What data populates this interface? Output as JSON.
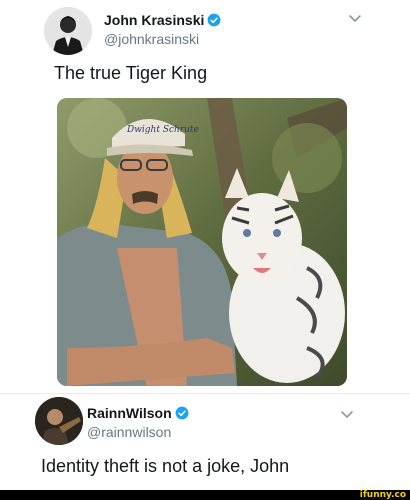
{
  "tweet1": {
    "name": "John Krasinski",
    "handle": "@johnkrasinski",
    "text": "The true Tiger King",
    "avatar_icon": "person-suit-avatar",
    "verified_icon": "verified-badge-icon",
    "menu_icon": "chevron-down-icon"
  },
  "tweet2": {
    "name": "RainnWilson",
    "handle": "@rainnwilson",
    "text": "Identity theft is not a joke, John",
    "avatar_icon": "person-avatar",
    "verified_icon": "verified-badge-icon",
    "menu_icon": "chevron-down-icon"
  },
  "photo": {
    "cap_text": "Dwight Schrute"
  },
  "watermark": "ifunny.co",
  "colors": {
    "verified": "#1da1f2",
    "handle": "#657786",
    "text": "#14171a",
    "watermark": "#f5d000"
  }
}
